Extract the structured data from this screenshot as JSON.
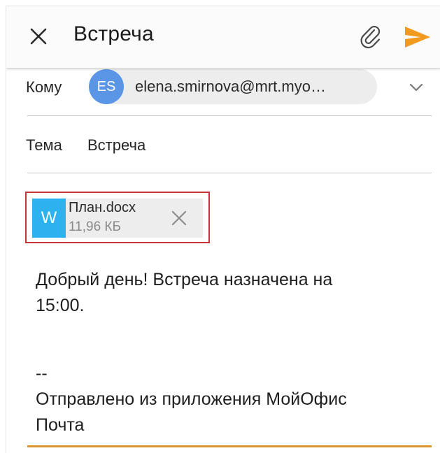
{
  "header": {
    "title": "Встреча",
    "accent_color": "#f29a1f",
    "close_icon": "close-icon",
    "attach_icon": "paperclip-icon",
    "send_icon": "send-icon"
  },
  "to": {
    "label": "Кому",
    "recipient_initials": "ES",
    "recipient_address": "elena.smirnova@mrt.myo…",
    "avatar_color": "#5b96e6",
    "expand_icon": "chevron-down-icon"
  },
  "subject": {
    "label": "Тема",
    "value": "Встреча"
  },
  "attachment": {
    "icon_letter": "W",
    "file_name": "План.docx",
    "file_size": "11,96 КБ",
    "highlight_color": "#c9323a",
    "remove_icon": "close-icon"
  },
  "message": {
    "line1": "Добрый день! Встреча назначена на",
    "line2": "15:00.",
    "signature_sep": "--",
    "signature_line1": "Отправлено из приложения МойОфис",
    "signature_line2": "Почта"
  }
}
